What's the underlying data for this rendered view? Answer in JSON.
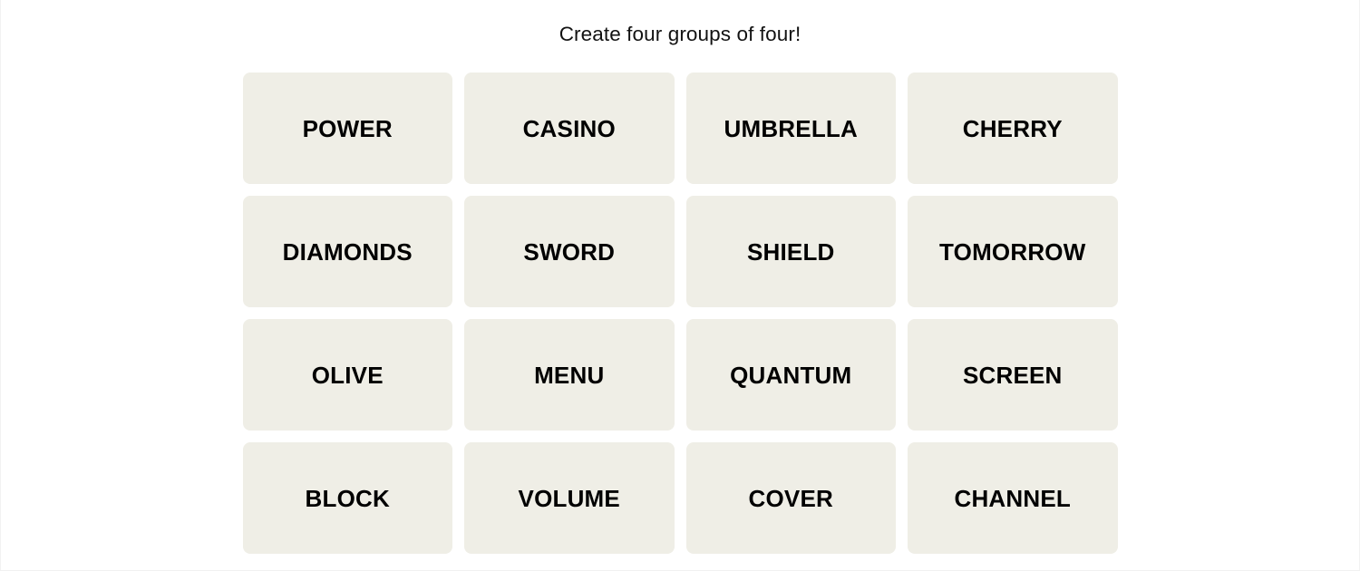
{
  "header": {
    "instruction": "Create four groups of four!"
  },
  "colors": {
    "page_background": "#ffffff",
    "tile_background": "#EFEEE6",
    "tile_text": "#000000",
    "instruction_text": "#121212"
  },
  "board": {
    "rows": 4,
    "columns": 4,
    "tiles": [
      {
        "label": "POWER"
      },
      {
        "label": "CASINO"
      },
      {
        "label": "UMBRELLA"
      },
      {
        "label": "CHERRY"
      },
      {
        "label": "DIAMONDS"
      },
      {
        "label": "SWORD"
      },
      {
        "label": "SHIELD"
      },
      {
        "label": "TOMORROW"
      },
      {
        "label": "OLIVE"
      },
      {
        "label": "MENU"
      },
      {
        "label": "QUANTUM"
      },
      {
        "label": "SCREEN"
      },
      {
        "label": "BLOCK"
      },
      {
        "label": "VOLUME"
      },
      {
        "label": "COVER"
      },
      {
        "label": "CHANNEL"
      }
    ]
  }
}
